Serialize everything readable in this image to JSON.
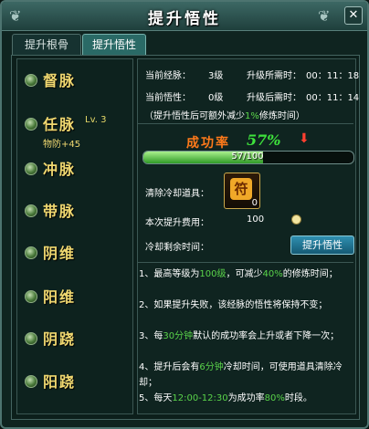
{
  "window": {
    "title": "提升悟性",
    "close_label": "✕"
  },
  "tabs": [
    {
      "label": "提升根骨",
      "active": false
    },
    {
      "label": "提升悟性",
      "active": true
    }
  ],
  "meridians": [
    {
      "name": "督脉"
    },
    {
      "name": "任脉",
      "level": "Lv. 3",
      "bonus": "物防+45",
      "selected": true
    },
    {
      "name": "冲脉"
    },
    {
      "name": "带脉"
    },
    {
      "name": "阴维"
    },
    {
      "name": "阳维"
    },
    {
      "name": "阴跷"
    },
    {
      "name": "阳跷"
    }
  ],
  "stats": {
    "cur_meridian_label": "当前经脉：",
    "cur_meridian_value": "3级",
    "upgrade_time_label": "升级所需时：",
    "upgrade_time_value": "00：11：18",
    "cur_insight_label": "当前悟性：",
    "cur_insight_value": "0级",
    "after_time_label": "升级后需时：",
    "after_time_value": "00：11：14",
    "note_prefix": "（提升悟性后可额外减少",
    "note_value": "1%",
    "note_suffix": "修炼时间）"
  },
  "success": {
    "label": "成功率",
    "value": "57%",
    "trend": "down"
  },
  "progress": {
    "text": "57/100",
    "current": 57,
    "max": 100
  },
  "item": {
    "label": "清除冷却道具：",
    "count": "0",
    "icon": "scroll-token-icon"
  },
  "cost": {
    "label": "本次提升费用：",
    "value": "100",
    "currency_icon": "silver-coin-icon"
  },
  "cooldown": {
    "label": "冷却剩余时间：",
    "button_label": "提升悟性"
  },
  "rules": [
    {
      "a": "1、最高等级为",
      "h": "100级",
      "b": "，可减少",
      "h2": "40%",
      "c": "的修炼时间；"
    },
    {
      "a": "2、如果提升失败，该经脉的悟性将保持不变；"
    },
    {
      "a": "3、每",
      "h": "30分钟",
      "b": "默认的成功率会上升或者下降一次；"
    },
    {
      "a": "4、提升后会有",
      "h": "6分钟",
      "b": "冷却时间，可使用道具清除冷却；"
    },
    {
      "a": "5、每天",
      "h": "12:00-12:30",
      "b": "为成功率",
      "h2": "80%",
      "c": "时段。"
    }
  ],
  "colors": {
    "accent_gold": "#f0d870",
    "highlight_green": "#5ad44a",
    "success_orange": "#ff7a1a",
    "bar_green": "#3ee33c"
  }
}
